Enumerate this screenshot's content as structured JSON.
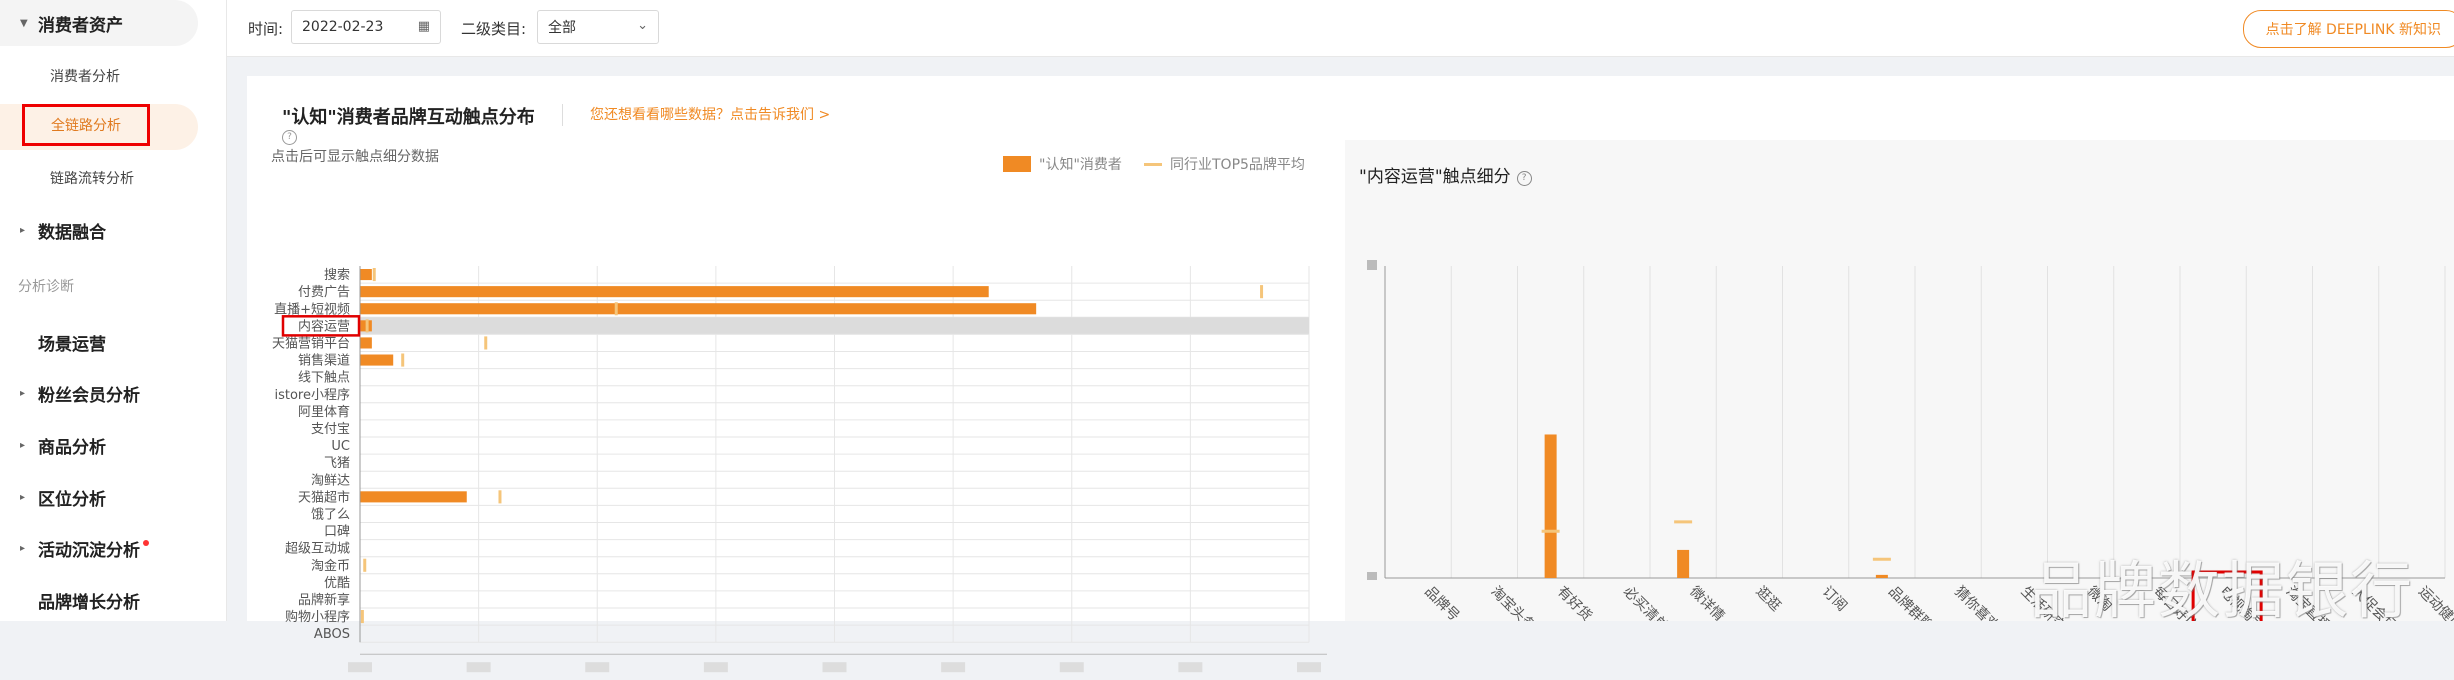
{
  "sidebar": {
    "top_section": "消费者资产",
    "items": [
      {
        "label": "消费者分析",
        "type": "sub"
      },
      {
        "label": "全链路分析",
        "type": "sub",
        "active": true
      },
      {
        "label": "链路流转分析",
        "type": "sub"
      }
    ],
    "sections": [
      {
        "label": "数据融合",
        "caret": true
      },
      {
        "label": "场景运营",
        "caret": false
      },
      {
        "label": "粉丝会员分析",
        "caret": true
      },
      {
        "label": "商品分析",
        "caret": true
      },
      {
        "label": "区位分析",
        "caret": true
      },
      {
        "label": "活动沉淀分析",
        "caret": true,
        "badge": true
      },
      {
        "label": "品牌增长分析",
        "caret": false
      }
    ],
    "group_label": "分析诊断"
  },
  "toolbar": {
    "time_label": "时间:",
    "date_value": "2022-02-23",
    "category_label": "二级类目:",
    "category_value": "全部",
    "cta_label": "点击了解 DEEPLINK 新知识"
  },
  "panel": {
    "title": "\"认知\"消费者品牌互动触点分布",
    "feedback_link": "您还想看看哪些数据？点击告诉我们 >",
    "hint": "点击后可显示触点细分数据",
    "legend": [
      "\"认知\"消费者",
      "同行业TOP5品牌平均"
    ],
    "colors": {
      "primary": "#f08a24",
      "secondary": "#f5c57a",
      "highlight": "#e00000"
    }
  },
  "right_panel": {
    "title": "\"内容运营\"触点细分"
  },
  "watermark": "品牌数据银行",
  "chart_data": [
    {
      "type": "bar",
      "orientation": "horizontal",
      "categories": [
        "搜索",
        "付费广告",
        "直播+短视频",
        "内容运营",
        "天猫营销平台",
        "销售渠道",
        "线下触点",
        "istore小程序",
        "阿里体育",
        "支付宝",
        "UC",
        "飞猪",
        "淘鲜达",
        "天猫超市",
        "饿了么",
        "口碑",
        "超级互动城",
        "淘金币",
        "优酷",
        "品牌新享",
        "购物小程序",
        "ABOS"
      ],
      "series": [
        {
          "name": "\"认知\"消费者",
          "values": [
            0.5,
            26.5,
            28.5,
            0.5,
            0.5,
            1.4,
            0,
            0,
            0,
            0,
            0,
            0,
            0,
            4.5,
            0,
            0,
            0,
            0,
            0,
            0,
            0,
            0
          ]
        },
        {
          "name": "同行业TOP5品牌平均",
          "values": [
            0.6,
            38,
            10.8,
            0.3,
            5.3,
            1.8,
            0,
            0,
            0,
            0,
            0,
            0,
            0,
            5.9,
            0,
            0,
            0,
            0.2,
            0,
            0,
            0.1,
            0
          ]
        }
      ],
      "highlight_category": "内容运营",
      "xlim": [
        0,
        40
      ]
    },
    {
      "type": "bar",
      "categories": [
        "品牌号",
        "淘宝头条",
        "有好货",
        "必买清单",
        "微详情",
        "逛逛",
        "订阅",
        "品牌群聊",
        "猜你喜欢",
        "生活研究所",
        "微淘",
        "每日好店",
        "电视淘宝",
        "淘宝直播",
        "大促会场",
        "运动健康"
      ],
      "series": [
        {
          "name": "\"认知\"消费者",
          "values": [
            0,
            0,
            46,
            0,
            9,
            0,
            0,
            1,
            0,
            0,
            0,
            0,
            0,
            0,
            0,
            0
          ]
        },
        {
          "name": "同行业TOP5品牌平均",
          "values": [
            0,
            0,
            15,
            0,
            18,
            0,
            0,
            6,
            0,
            0,
            0,
            0,
            0,
            0,
            0,
            0
          ]
        }
      ],
      "highlight_category": "电视淘宝",
      "ylim": [
        0,
        100
      ]
    }
  ]
}
